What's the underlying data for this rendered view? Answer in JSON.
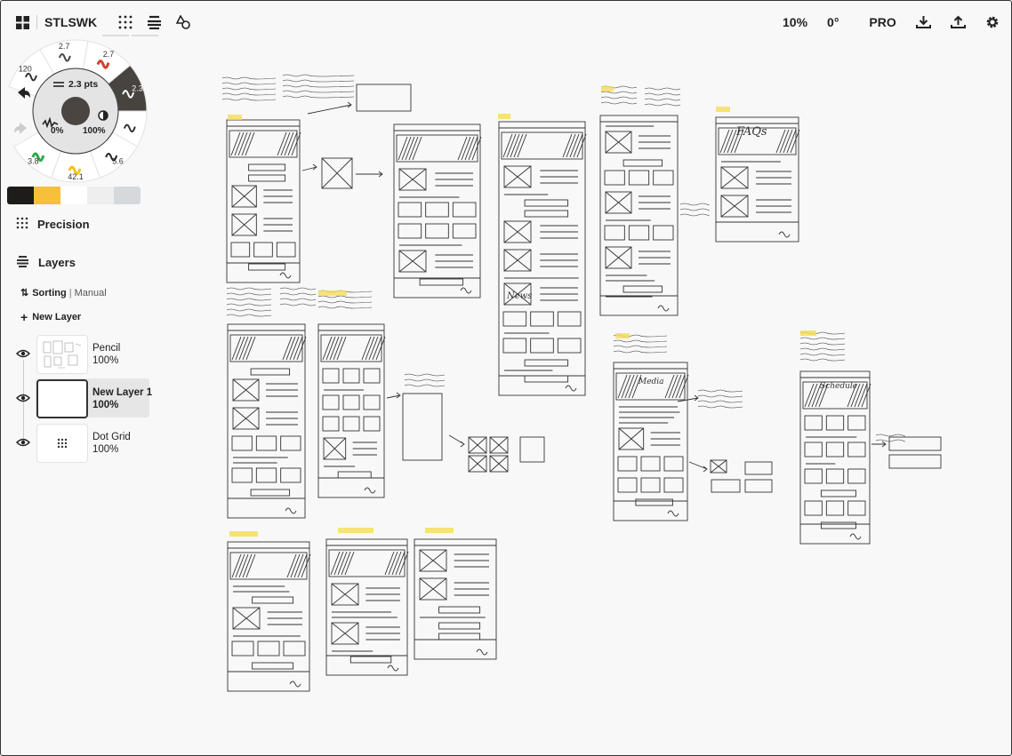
{
  "header": {
    "doc_title": "STLSWK",
    "zoom": "10%",
    "rotation": "0°",
    "pro_label": "PRO"
  },
  "tool_wheel": {
    "size_label": "2.3 pts",
    "smoothing": "0%",
    "opacity": "100%",
    "presets": [
      "120",
      "2.7",
      "2.7",
      "2.3",
      "5.6",
      "42.1",
      "3.8"
    ],
    "active_preset": "2.3"
  },
  "swatches": [
    "#1e1c1a",
    "#f7bf3a",
    "#ffffff",
    "#eeeeee",
    "#d6d9dc"
  ],
  "sidebar": {
    "precision_label": "Precision",
    "layers_label": "Layers",
    "sorting_label": "Sorting",
    "sorting_value": "Manual",
    "new_layer_label": "New Layer",
    "layers": [
      {
        "name": "Pencil",
        "opacity": "100%"
      },
      {
        "name": "New Layer 1",
        "opacity": "100%",
        "selected": true
      },
      {
        "name": "Dot Grid",
        "opacity": "100%"
      }
    ]
  },
  "canvas": {
    "labels": {
      "faq": "FAQs",
      "news": "News",
      "media": "Media",
      "schedule": "Schedule"
    }
  }
}
